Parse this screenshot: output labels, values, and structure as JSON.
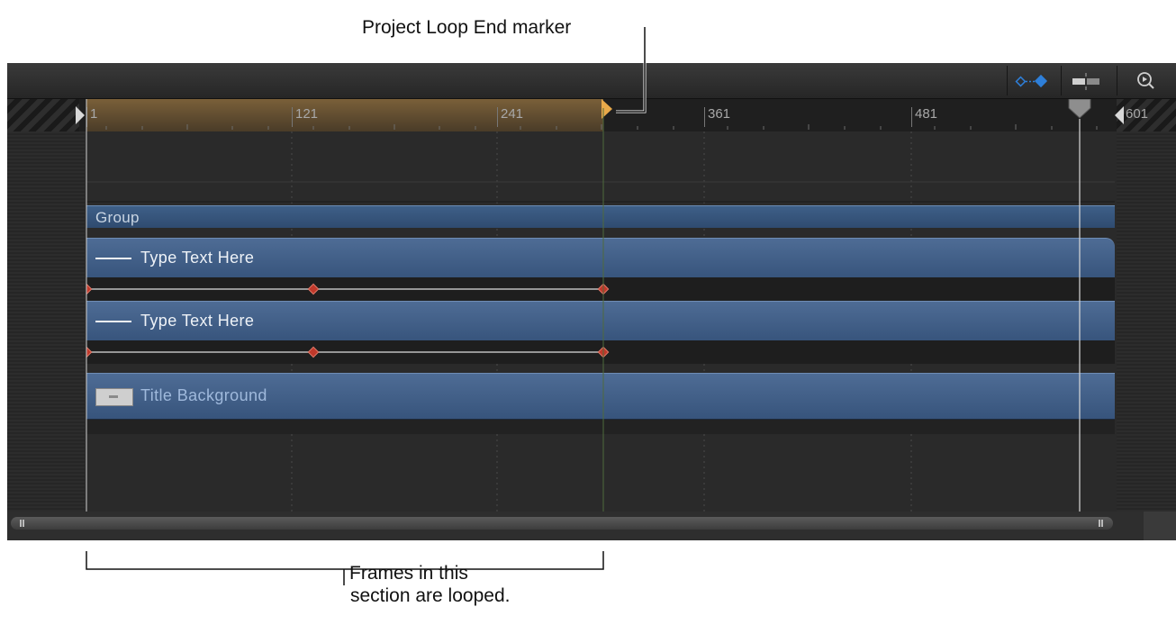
{
  "callouts": {
    "loop_end": "Project Loop End marker",
    "looped_line1": "Frames in this",
    "looped_line2": "section are looped."
  },
  "toolbar": {
    "keyframe_icon": "show-keyframes-icon",
    "snap_icon": "snap-icon",
    "zoom_icon": "zoom-icon"
  },
  "ruler": {
    "ticks": [
      "1",
      "121",
      "241",
      "361",
      "481",
      "601"
    ]
  },
  "timeline": {
    "group_label": "Group",
    "layers": [
      {
        "label": "Type Text Here",
        "type": "text"
      },
      {
        "label": "Type Text Here",
        "type": "text"
      },
      {
        "label": "Title Background",
        "type": "image"
      }
    ]
  },
  "colors": {
    "play_range": "#7a6039",
    "loop_marker": "#e8a94a",
    "layer_blue": "#4e6c95",
    "keyframe_red": "#c0392b",
    "accent_blue": "#2e7fd9"
  }
}
